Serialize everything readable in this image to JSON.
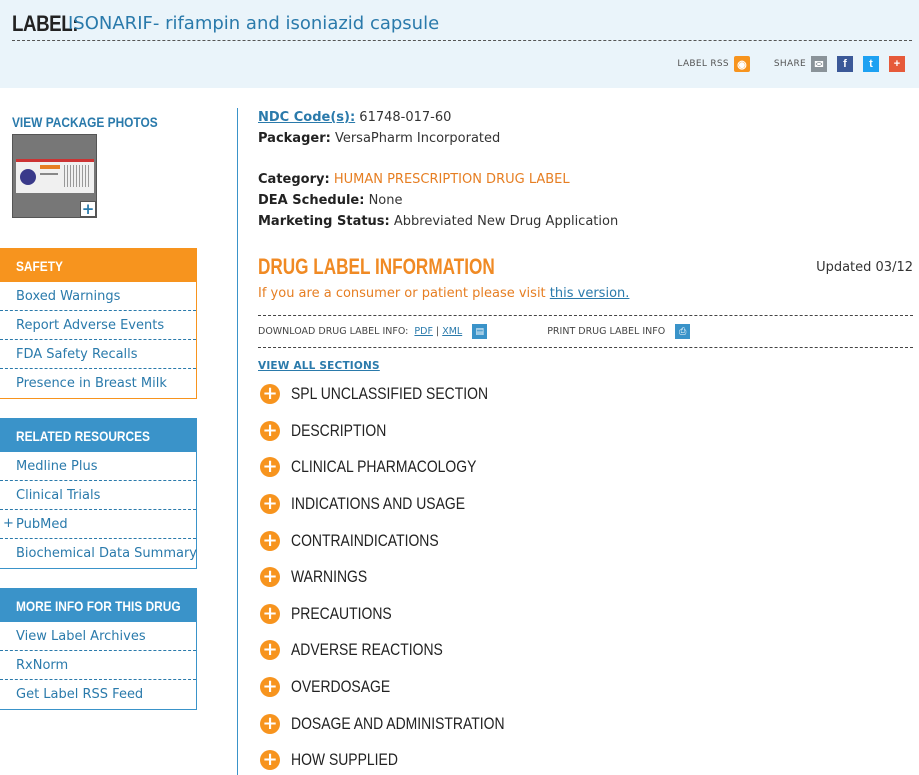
{
  "header": {
    "label_prefix": "LABEL:",
    "title": "ISONARIF- rifampin and isoniazid capsule",
    "label_rss": "LABEL RSS",
    "share": "SHARE"
  },
  "sidebar": {
    "package_photos": "VIEW PACKAGE PHOTOS",
    "safety": {
      "title": "SAFETY",
      "items": [
        "Boxed Warnings",
        "Report Adverse Events",
        "FDA Safety Recalls",
        "Presence in Breast Milk"
      ]
    },
    "related": {
      "title": "RELATED RESOURCES",
      "items": [
        "Medline Plus",
        "Clinical Trials",
        "PubMed",
        "Biochemical Data Summary"
      ]
    },
    "moreinfo": {
      "title": "MORE INFO FOR THIS DRUG",
      "items": [
        "View Label Archives",
        "RxNorm",
        "Get Label RSS Feed"
      ]
    }
  },
  "meta": {
    "ndc_key": "NDC Code(s):",
    "ndc_val": "61748-017-60",
    "packager_key": "Packager:",
    "packager_val": "VersaPharm Incorporated",
    "category_key": "Category:",
    "category_val": "HUMAN PRESCRIPTION DRUG LABEL",
    "dea_key": "DEA Schedule:",
    "dea_val": "None",
    "marketing_key": "Marketing Status:",
    "marketing_val": "Abbreviated New Drug Application"
  },
  "dli": {
    "title": "DRUG LABEL INFORMATION",
    "updated": "Updated 03/12",
    "consumer_text": "If you are a consumer or patient please visit",
    "consumer_link": "this version.",
    "download_label": "DOWNLOAD DRUG LABEL INFO:",
    "pdf": "PDF",
    "sep": "|",
    "xml": "XML",
    "print_label": "PRINT DRUG LABEL INFO",
    "view_all": "VIEW ALL SECTIONS"
  },
  "sections": [
    "SPL UNCLASSIFIED SECTION",
    "DESCRIPTION",
    "CLINICAL PHARMACOLOGY",
    "INDICATIONS AND USAGE",
    "CONTRAINDICATIONS",
    "WARNINGS",
    "PRECAUTIONS",
    "ADVERSE REACTIONS",
    "OVERDOSAGE",
    "DOSAGE AND ADMINISTRATION",
    "HOW SUPPLIED"
  ],
  "colors": {
    "accent_orange": "#f7941e",
    "accent_blue": "#3a93c9",
    "link_blue": "#2a7aab",
    "header_bg": "#eaf4fa"
  }
}
